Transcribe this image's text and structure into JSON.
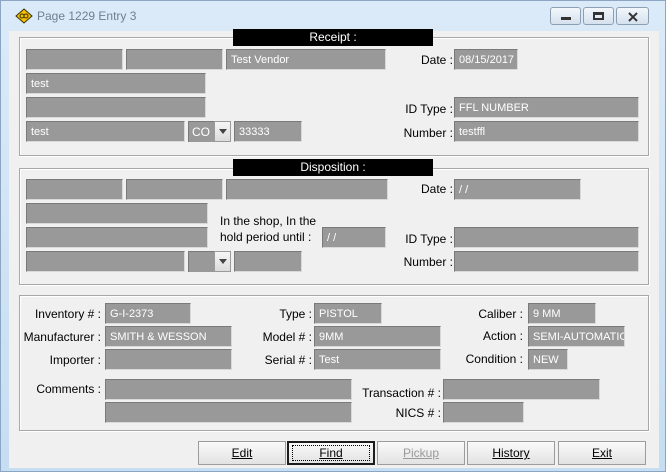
{
  "window": {
    "title": "Page 1229  Entry 3"
  },
  "receipt": {
    "title": "Receipt :",
    "name_field_1": "",
    "name_field_2": "",
    "vendor": "Test Vendor",
    "address_1": "test",
    "address_2": "",
    "city": "test",
    "state": "CO",
    "zip": "33333",
    "date_label": "Date :",
    "date": "08/15/2017",
    "id_type_label": "ID Type :",
    "id_type": "FFL NUMBER",
    "number_label": "Number :",
    "number": "testffl"
  },
  "disposition": {
    "title": "Disposition :",
    "name_field_1": "",
    "name_field_2": "",
    "name_field_3": "",
    "address_1": "",
    "address_2": "",
    "city": "",
    "state": "",
    "zip": "",
    "hold_label_line1": "In the shop, In the",
    "hold_label_line2": "hold period until :",
    "hold_date": "  /  /",
    "date_label": "Date :",
    "date": "  /  /",
    "id_type_label": "ID Type :",
    "id_type": "",
    "number_label": "Number :",
    "number": ""
  },
  "firearm": {
    "inventory_label": "Inventory # :",
    "inventory": "G-I-2373",
    "type_label": "Type :",
    "type": "PISTOL",
    "caliber_label": "Caliber :",
    "caliber": "9 MM",
    "manufacturer_label": "Manufacturer :",
    "manufacturer": "SMITH & WESSON",
    "model_label": "Model # :",
    "model": "9MM",
    "action_label": "Action :",
    "action": "SEMI-AUTOMATIC",
    "importer_label": "Importer :",
    "importer": "",
    "serial_label": "Serial # :",
    "serial": "Test",
    "condition_label": "Condition :",
    "condition": "NEW",
    "comments_label": "Comments :",
    "comments_1": "",
    "comments_2": "",
    "transaction_label": "Transaction # :",
    "transaction": "",
    "nics_label": "NICS # :",
    "nics": ""
  },
  "buttons": {
    "edit": "Edit",
    "find": "Find",
    "pickup": "Pickup",
    "history": "History",
    "exit": "Exit"
  }
}
